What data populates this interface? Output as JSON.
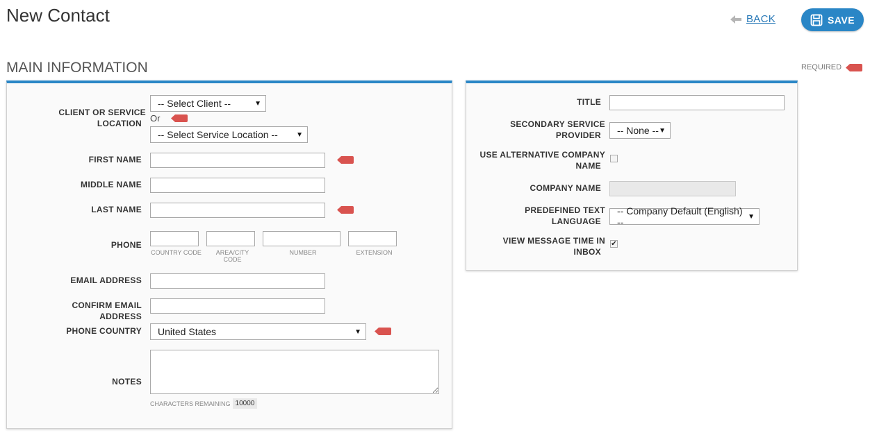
{
  "header": {
    "title": "New Contact",
    "back_label": "BACK",
    "save_label": "SAVE"
  },
  "section": {
    "title": "MAIN INFORMATION",
    "required_label": "REQUIRED"
  },
  "left_form": {
    "client_label_line1": "CLIENT OR SERVICE",
    "client_label_line2": "LOCATION",
    "select_client": "-- Select Client --",
    "or_text": "Or",
    "select_location": "-- Select Service Location --",
    "first_name_label": "FIRST NAME",
    "middle_name_label": "MIDDLE NAME",
    "last_name_label": "LAST NAME",
    "phone_label": "PHONE",
    "phone_country_code": "COUNTRY CODE",
    "phone_area_line1": "AREA/CITY",
    "phone_area_line2": "CODE",
    "phone_number": "NUMBER",
    "phone_extension": "EXTENSION",
    "email_label": "EMAIL ADDRESS",
    "confirm_email_label": "CONFIRM EMAIL ADDRESS",
    "phone_country_label": "PHONE COUNTRY",
    "phone_country_value": "United States",
    "notes_label": "NOTES",
    "chars_remaining_label": "CHARACTERS REMAINING",
    "chars_remaining_value": "10000"
  },
  "right_form": {
    "title_label": "TITLE",
    "secondary_label_line1": "SECONDARY SERVICE",
    "secondary_label_line2": "PROVIDER",
    "secondary_value": "-- None --",
    "alt_company_line1": "USE ALTERNATIVE COMPANY",
    "alt_company_line2": "NAME",
    "alt_company_checked": false,
    "company_name_label": "COMPANY NAME",
    "predefined_line1": "PREDEFINED TEXT",
    "predefined_line2": "LANGUAGE",
    "predefined_value": "-- Company Default (English) --",
    "view_msg_line1": "VIEW MESSAGE TIME IN",
    "view_msg_line2": "INBOX",
    "view_msg_checked": true
  },
  "colors": {
    "accent": "#2a86c6",
    "required_flag": "#d9534f",
    "link": "#2a7ab8"
  }
}
